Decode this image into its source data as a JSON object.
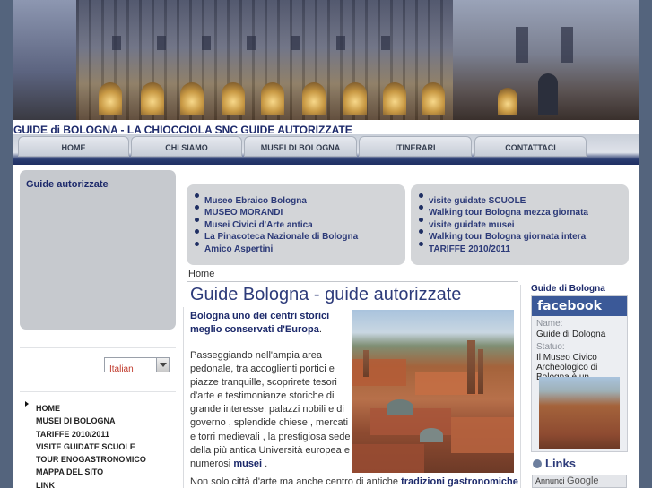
{
  "site": {
    "title": "GUIDE di BOLOGNA - LA CHIOCCIOLA SNC GUIDE AUTORIZZATE"
  },
  "nav": {
    "tabs": [
      "HOME",
      "CHI SIAMO",
      "MUSEI DI BOLOGNA",
      "ITINERARI",
      "CONTATTACI"
    ]
  },
  "left": {
    "box_title": "Guide autorizzate",
    "language": "Italian",
    "menu": [
      "HOME",
      "MUSEI DI BOLOGNA",
      "TARIFFE 2010/2011",
      "VISITE GUIDATE SCUOLE",
      "TOUR ENOGASTRONOMICO",
      "MAPPA DEL SITO",
      "LINK"
    ]
  },
  "link_boxes": {
    "left": [
      "Museo Ebraico Bologna",
      "MUSEO MORANDI",
      "Musei Civici d'Arte antica",
      "La Pinacoteca Nazionale di Bologna",
      "Amico Aspertini"
    ],
    "right": [
      "visite guidate SCUOLE",
      "Walking tour Bologna mezza giornata",
      "visite guidate musei",
      "Walking tour Bologna giornata intera",
      "TARIFFE 2010/2011"
    ]
  },
  "main": {
    "breadcrumb": "Home",
    "title": "Guide Bologna - guide autorizzate",
    "intro_bold": "Bologna uno dei centri storici meglio conservati d'Europa",
    "intro_end": ".",
    "body": "Passeggiando nell'ampia area pedonale, tra accoglienti portici e piazze tranquille, scoprirete tesori d'arte e testimonianze storiche di grande interesse: palazzi nobili e di governo , splendide chiese , mercati e torri medievali , la prestigiosa sede della più antica Università europea e numerosi",
    "body_link": "musei",
    "body_end": " .",
    "bottom_start": "Non solo città d'arte ma anche centro di antiche ",
    "bottom_link": "tradizioni gastronomiche"
  },
  "right": {
    "fb_title": "Guide di Bologna",
    "fb_brand": "facebook",
    "fb_name_label": "Name:",
    "fb_name": "Guide di Dologna",
    "fb_status_label": "Statuo:",
    "fb_status": "Il Museo Civico Archeologico di Bologna è un...",
    "links_title": "Links",
    "ads_label": "Annunci",
    "ads_brand": "Google"
  },
  "colors": {
    "navy": "#1d2a6b",
    "link_blue": "#2c3a78",
    "facebook": "#3b5998",
    "panel_grey": "#c6c9ce"
  }
}
